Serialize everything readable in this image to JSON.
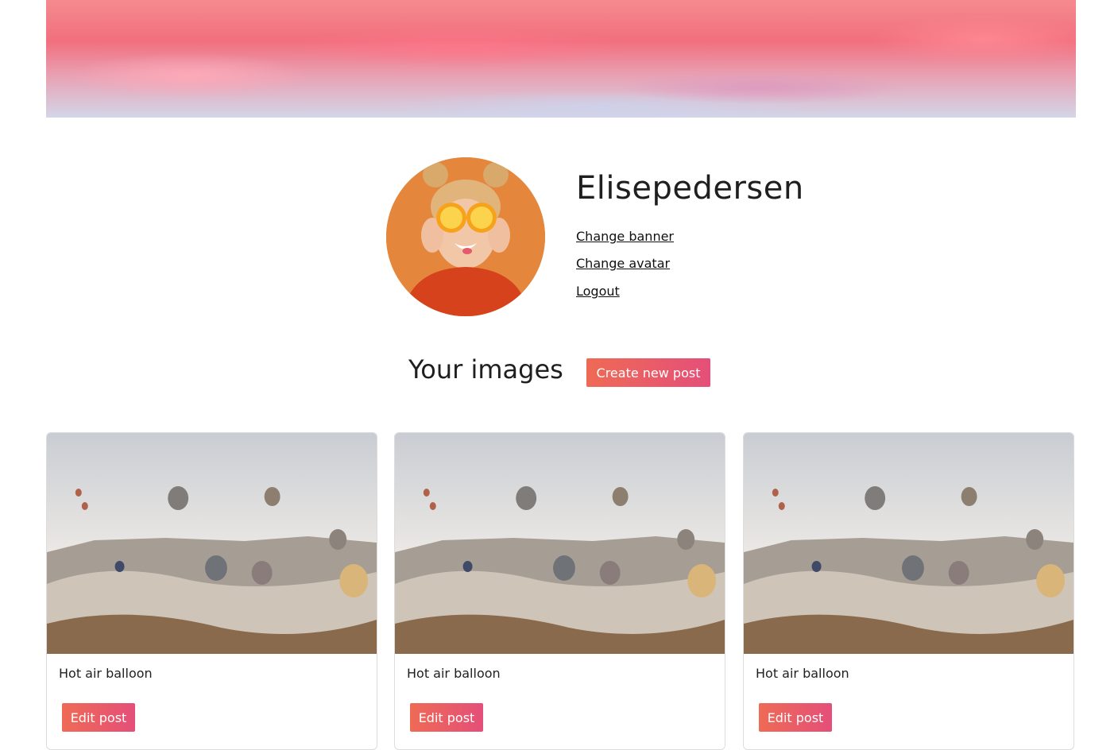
{
  "profile": {
    "username": "Elisepedersen",
    "links": {
      "change_banner": "Change banner",
      "change_avatar": "Change avatar",
      "logout": "Logout"
    }
  },
  "images_section": {
    "title": "Your images",
    "create_button": "Create new post"
  },
  "posts": [
    {
      "title": "Hot air balloon",
      "edit_label": "Edit post"
    },
    {
      "title": "Hot air balloon",
      "edit_label": "Edit post"
    },
    {
      "title": "Hot air balloon",
      "edit_label": "Edit post"
    }
  ],
  "colors": {
    "button_gradient_start": "#ef6a55",
    "button_gradient_end": "#e44f79",
    "text": "#1f1f1f"
  }
}
